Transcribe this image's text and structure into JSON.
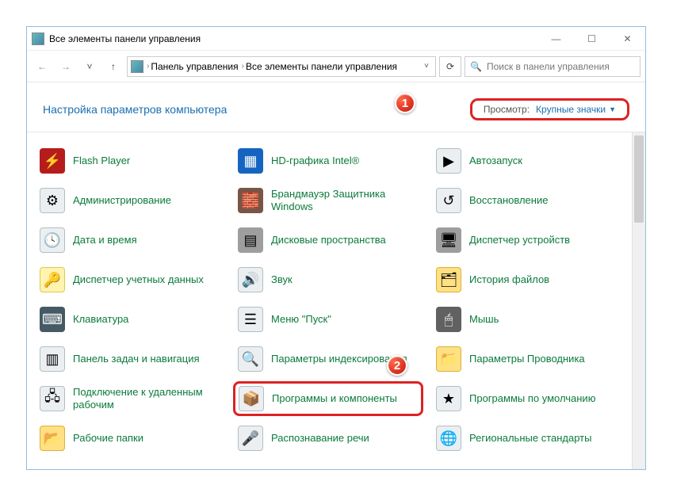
{
  "window": {
    "title": "Все элементы панели управления"
  },
  "nav": {
    "back_enabled": false,
    "forward_enabled": false,
    "breadcrumb": [
      {
        "label": "Панель управления"
      },
      {
        "label": "Все элементы панели управления"
      }
    ]
  },
  "search": {
    "placeholder": "Поиск в панели управления"
  },
  "subheader": {
    "title": "Настройка параметров компьютера"
  },
  "viewby": {
    "label": "Просмотр:",
    "value": "Крупные значки"
  },
  "badges": {
    "one": "1",
    "two": "2"
  },
  "items": [
    {
      "name": "flash-player",
      "label": "Flash Player",
      "icon": "i-flash",
      "glyph": "⚡"
    },
    {
      "name": "intel-hd",
      "label": "HD-графика Intel®",
      "icon": "i-intel",
      "glyph": "▦"
    },
    {
      "name": "autoplay",
      "label": "Автозапуск",
      "icon": "i-auto",
      "glyph": "▶"
    },
    {
      "name": "administration",
      "label": "Администрирование",
      "icon": "i-admin",
      "glyph": "⚙"
    },
    {
      "name": "firewall",
      "label": "Брандмауэр Защитника Windows",
      "icon": "i-fire",
      "glyph": "🧱"
    },
    {
      "name": "recovery",
      "label": "Восстановление",
      "icon": "i-rest",
      "glyph": "↺"
    },
    {
      "name": "date-time",
      "label": "Дата и время",
      "icon": "i-date",
      "glyph": "🕓"
    },
    {
      "name": "storage-spaces",
      "label": "Дисковые пространства",
      "icon": "i-disk",
      "glyph": "▤"
    },
    {
      "name": "device-manager",
      "label": "Диспетчер устройств",
      "icon": "i-dev",
      "glyph": "🖥"
    },
    {
      "name": "credential-mgr",
      "label": "Диспетчер учетных данных",
      "icon": "i-acct",
      "glyph": "🔑"
    },
    {
      "name": "sound",
      "label": "Звук",
      "icon": "i-snd",
      "glyph": "🔊"
    },
    {
      "name": "file-history",
      "label": "История файлов",
      "icon": "i-hist",
      "glyph": "🗂"
    },
    {
      "name": "keyboard",
      "label": "Клавиатура",
      "icon": "i-kbd",
      "glyph": "⌨"
    },
    {
      "name": "start-menu",
      "label": "Меню \"Пуск\"",
      "icon": "i-start",
      "glyph": "☰"
    },
    {
      "name": "mouse",
      "label": "Мышь",
      "icon": "i-mouse",
      "glyph": "🖱"
    },
    {
      "name": "taskbar-nav",
      "label": "Панель задач и навигация",
      "icon": "i-task",
      "glyph": "▥"
    },
    {
      "name": "indexing",
      "label": "Параметры индексирования",
      "icon": "i-idx",
      "glyph": "🔍"
    },
    {
      "name": "explorer-options",
      "label": "Параметры Проводника",
      "icon": "i-expl",
      "glyph": "📁"
    },
    {
      "name": "remote-desktop",
      "label": "Подключение к удаленным рабочим",
      "icon": "i-rdp",
      "glyph": "🖧"
    },
    {
      "name": "programs-features",
      "label": "Программы и компоненты",
      "icon": "i-prog",
      "glyph": "📦",
      "highlight": true
    },
    {
      "name": "default-programs",
      "label": "Программы по умолчанию",
      "icon": "i-def",
      "glyph": "★"
    },
    {
      "name": "work-folders",
      "label": "Рабочие папки",
      "icon": "i-work",
      "glyph": "📂"
    },
    {
      "name": "speech",
      "label": "Распознавание речи",
      "icon": "i-speech",
      "glyph": "🎤"
    },
    {
      "name": "regional",
      "label": "Региональные стандарты",
      "icon": "i-reg",
      "glyph": "🌐"
    }
  ]
}
